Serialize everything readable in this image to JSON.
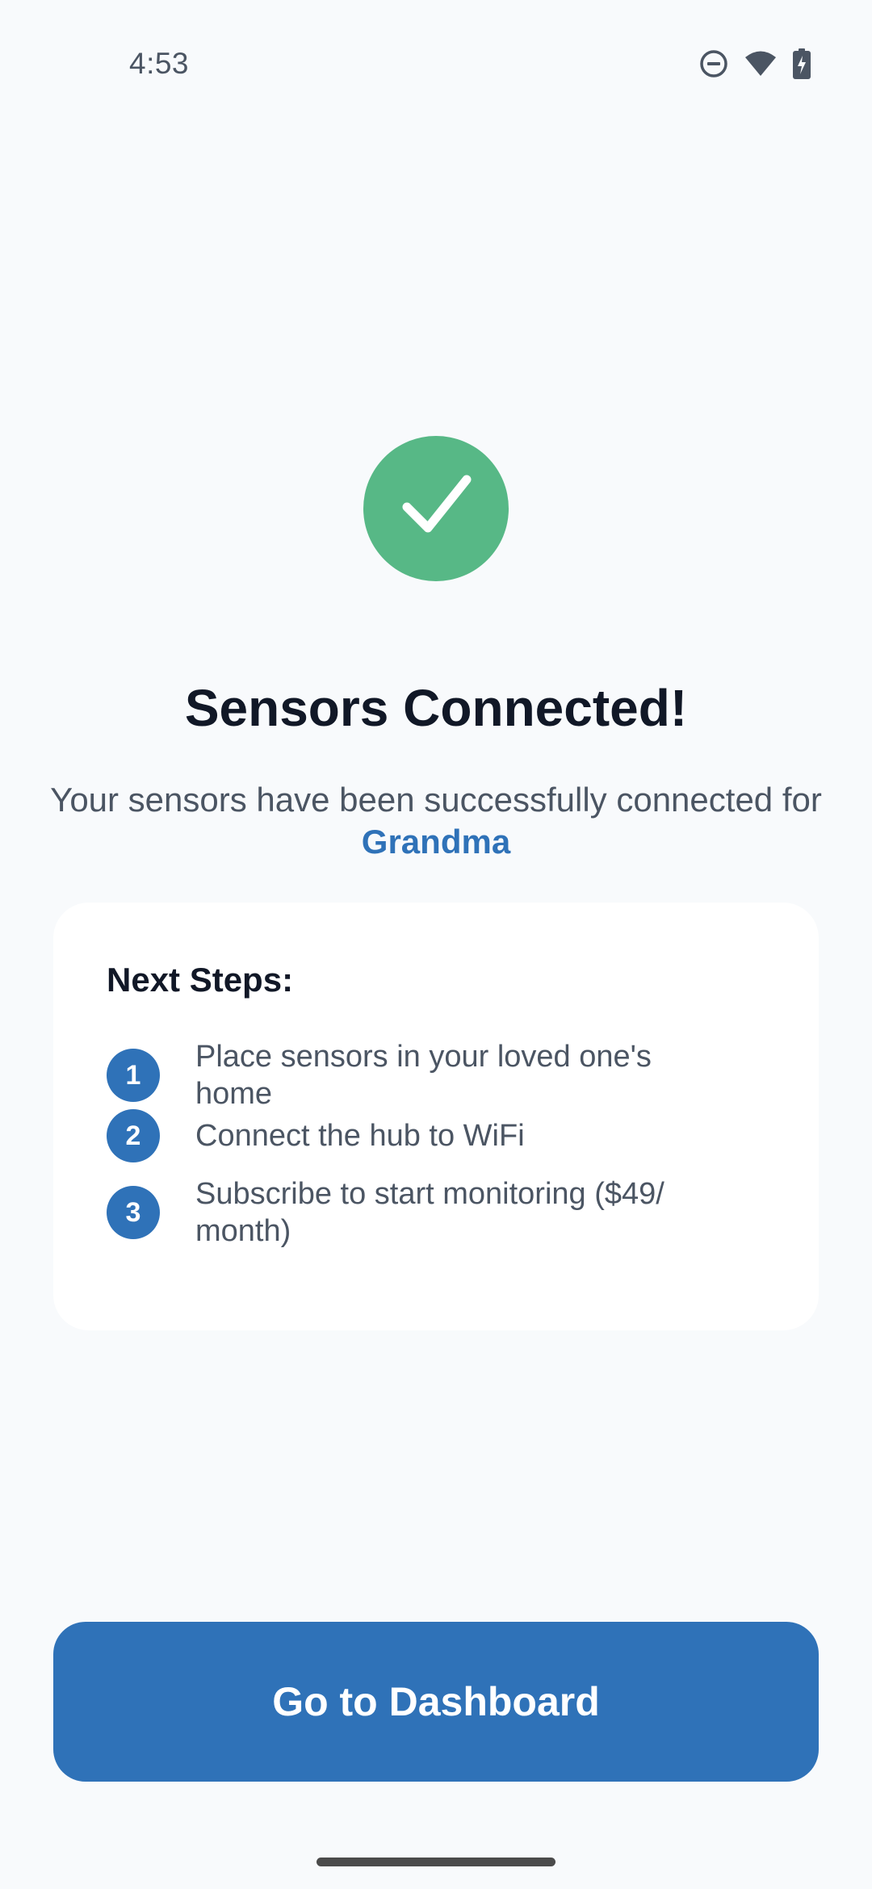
{
  "status_bar": {
    "time": "4:53",
    "icons": [
      "do-not-disturb-icon",
      "wifi-icon",
      "battery-charging-icon"
    ]
  },
  "success": {
    "icon": "checkmark-icon",
    "title": "Sensors Connected!",
    "subtitle_prefix": "Your sensors have been successfully connected for ",
    "subtitle_name": "Grandma"
  },
  "next_steps": {
    "title": "Next Steps:",
    "steps": [
      {
        "number": "1",
        "text": "Place sensors in your loved one's home"
      },
      {
        "number": "2",
        "text": "Connect the hub to WiFi"
      },
      {
        "number": "3",
        "text": "Subscribe to start monitoring ($49/ month)"
      }
    ]
  },
  "actions": {
    "primary_label": "Go to Dashboard"
  },
  "colors": {
    "background": "#f8fafc",
    "success_green": "#57b886",
    "accent_blue": "#2f72b8",
    "text_primary": "#111827",
    "text_secondary": "#4b5563"
  }
}
